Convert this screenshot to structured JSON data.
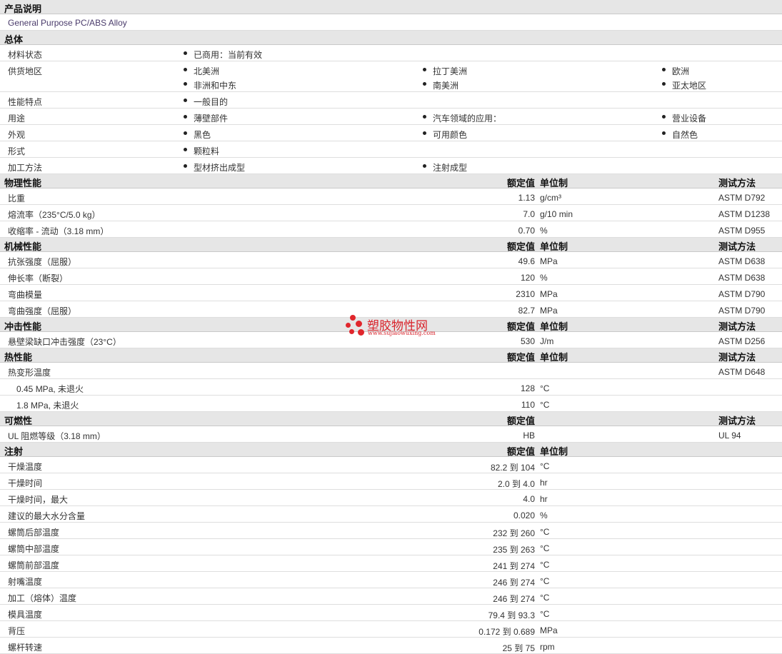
{
  "sections": {
    "desc": "产品说明",
    "general": "总体",
    "physical": "物理性能",
    "mechanical": "机械性能",
    "impact": "冲击性能",
    "thermal": "热性能",
    "flammability": "可燃性",
    "injection": "注射"
  },
  "headers": {
    "value": "额定值",
    "unit": "单位制",
    "method": "测试方法"
  },
  "description": "General Purpose PC/ABS Alloy",
  "general": {
    "material_status": {
      "label": "材料状态",
      "items": [
        "已商用：当前有效"
      ]
    },
    "availability": {
      "label": "供货地区",
      "items": [
        "北美洲",
        "拉丁美洲",
        "欧洲",
        "非洲和中东",
        "南美洲",
        "亚太地区"
      ]
    },
    "features": {
      "label": "性能特点",
      "items": [
        "一般目的"
      ]
    },
    "uses": {
      "label": "用途",
      "items": [
        "薄壁部件",
        "汽车领域的应用：",
        "营业设备"
      ]
    },
    "appearance": {
      "label": "外观",
      "items": [
        "黑色",
        "可用颜色",
        "自然色"
      ]
    },
    "form": {
      "label": "形式",
      "items": [
        "颗粒料"
      ]
    },
    "processing": {
      "label": "加工方法",
      "items": [
        "型材挤出成型",
        "注射成型"
      ]
    }
  },
  "physical": [
    {
      "label": "比重",
      "value": "1.13",
      "unit": "g/cm³",
      "method": "ASTM D792"
    },
    {
      "label": "熔流率（235°C/5.0 kg）",
      "value": "7.0",
      "unit": "g/10 min",
      "method": "ASTM D1238"
    },
    {
      "label": "收缩率 - 流动（3.18 mm）",
      "value": "0.70",
      "unit": "%",
      "method": "ASTM D955"
    }
  ],
  "mechanical": [
    {
      "label": "抗张强度（屈服）",
      "value": "49.6",
      "unit": "MPa",
      "method": "ASTM D638"
    },
    {
      "label": "伸长率（断裂）",
      "value": "120",
      "unit": "%",
      "method": "ASTM D638"
    },
    {
      "label": "弯曲模量",
      "value": "2310",
      "unit": "MPa",
      "method": "ASTM D790"
    },
    {
      "label": "弯曲强度（屈服）",
      "value": "82.7",
      "unit": "MPa",
      "method": "ASTM D790"
    }
  ],
  "impact": [
    {
      "label": "悬壁梁缺口冲击强度（23°C）",
      "value": "530",
      "unit": "J/m",
      "method": "ASTM D256"
    }
  ],
  "thermal": {
    "hdt": {
      "label": "热变形温度",
      "method": "ASTM D648"
    },
    "rows": [
      {
        "label": "0.45 MPa, 未退火",
        "value": "128",
        "unit": "°C"
      },
      {
        "label": "1.8 MPa, 未退火",
        "value": "110",
        "unit": "°C"
      }
    ]
  },
  "flammability": [
    {
      "label": "UL 阻燃等级（3.18 mm）",
      "value": "HB",
      "method": "UL 94"
    }
  ],
  "injection": [
    {
      "label": "干燥温度",
      "value": "82.2 到 104",
      "unit": "°C"
    },
    {
      "label": "干燥时间",
      "value": "2.0 到 4.0",
      "unit": "hr"
    },
    {
      "label": "干燥时间，最大",
      "value": "4.0",
      "unit": "hr"
    },
    {
      "label": "建议的最大水分含量",
      "value": "0.020",
      "unit": "%"
    },
    {
      "label": "螺筒后部温度",
      "value": "232 到 260",
      "unit": "°C"
    },
    {
      "label": "螺筒中部温度",
      "value": "235 到 263",
      "unit": "°C"
    },
    {
      "label": "螺筒前部温度",
      "value": "241 到 274",
      "unit": "°C"
    },
    {
      "label": "射嘴温度",
      "value": "246 到 274",
      "unit": "°C"
    },
    {
      "label": "加工（熔体）温度",
      "value": "246 到 274",
      "unit": "°C"
    },
    {
      "label": "模具温度",
      "value": "79.4 到 93.3",
      "unit": "°C"
    },
    {
      "label": "背压",
      "value": "0.172 到 0.689",
      "unit": "MPa"
    },
    {
      "label": "螺杆转速",
      "value": "25 到 75",
      "unit": "rpm"
    }
  ],
  "watermark": {
    "name": "塑胶物性网",
    "url": "www.sujiaowuxing.com"
  }
}
